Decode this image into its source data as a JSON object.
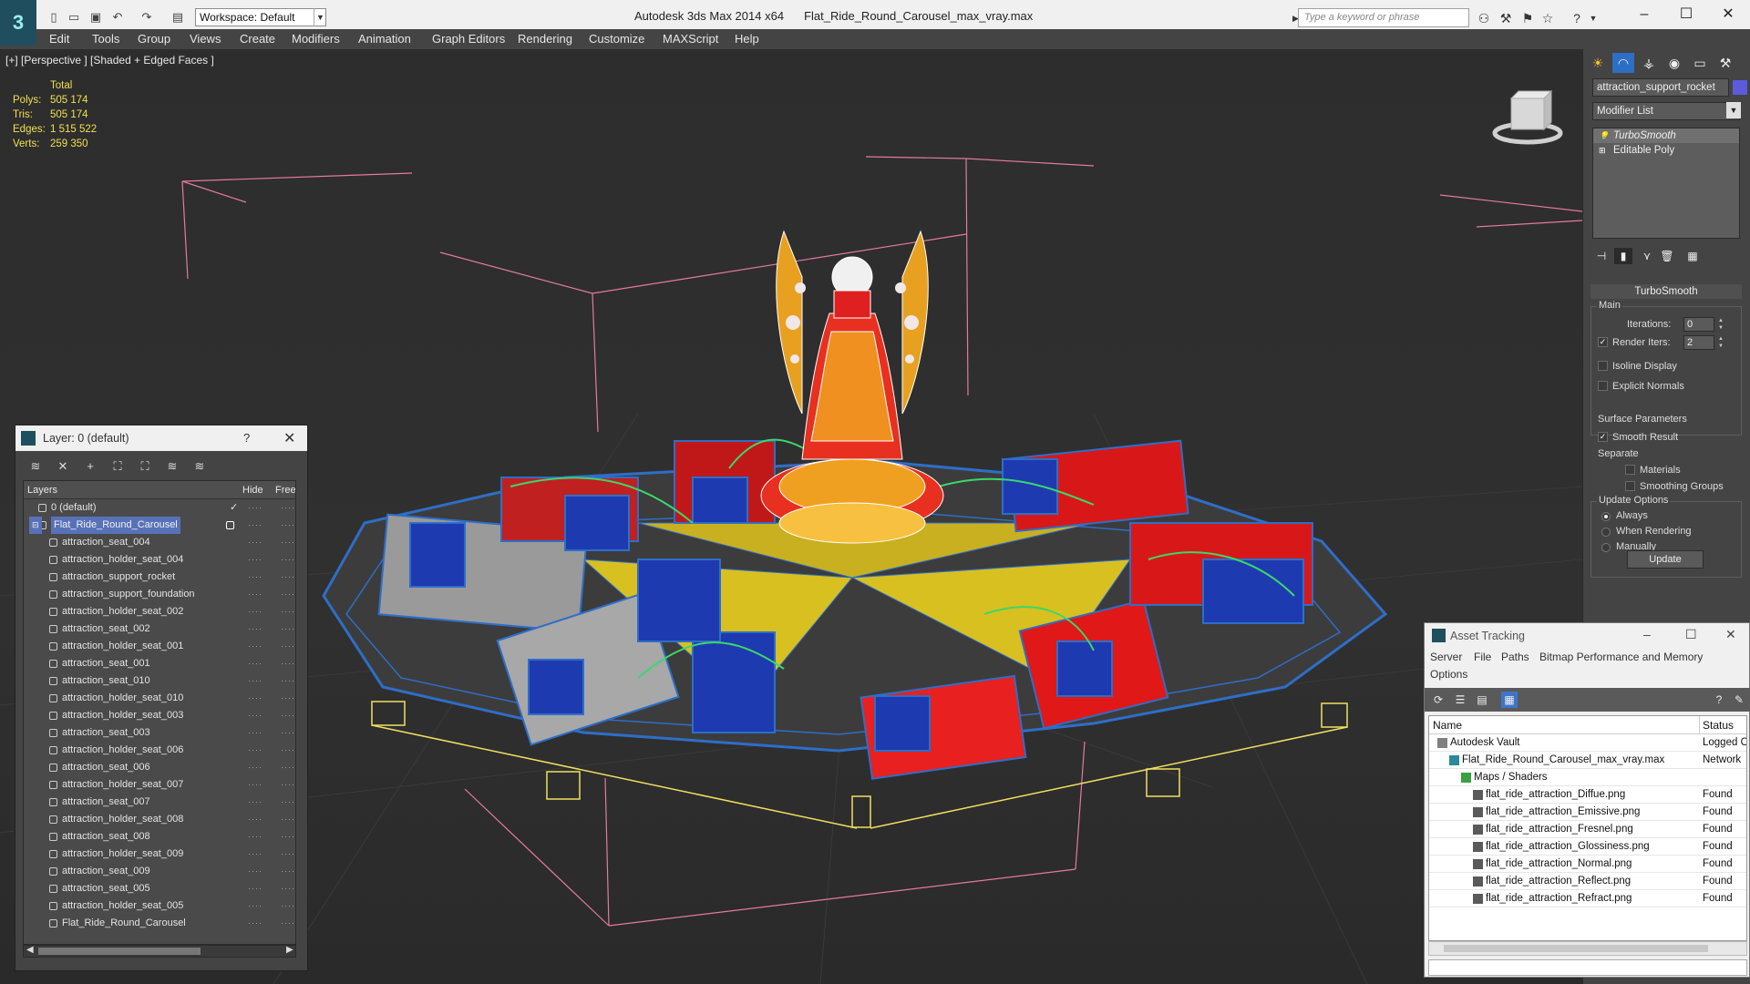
{
  "titlebar": {
    "workspace": "Workspace: Default",
    "app_name": "Autodesk 3ds Max  2014 x64",
    "file_name": "Flat_Ride_Round_Carousel_max_vray.max",
    "search_placeholder": "Type a keyword or phrase"
  },
  "menu": [
    "Edit",
    "Tools",
    "Group",
    "Views",
    "Create",
    "Modifiers",
    "Animation",
    "Graph Editors",
    "Rendering",
    "Customize",
    "MAXScript",
    "Help"
  ],
  "viewport": {
    "label": "[+] [Perspective ] [Shaded + Edged Faces ]",
    "stats_header": "Total",
    "stats": [
      {
        "name": "Polys:",
        "value": "505 174"
      },
      {
        "name": "Tris:",
        "value": "505 174"
      },
      {
        "name": "Edges:",
        "value": "1 515 522"
      },
      {
        "name": "Verts:",
        "value": "259 350"
      }
    ]
  },
  "command_panel": {
    "object_name": "attraction_support_rocket",
    "object_color": "#5b5bdc",
    "modifier_list": "Modifier List",
    "stack": [
      "TurboSmooth",
      "Editable Poly"
    ],
    "rollout": "TurboSmooth",
    "main_group": "Main",
    "iterations_label": "Iterations:",
    "iterations_value": "0",
    "render_iters_label": "Render Iters:",
    "render_iters_value": "2",
    "isoline_label": "Isoline Display",
    "explicit_normals_label": "Explicit Normals",
    "surface_group": "Surface Parameters",
    "smooth_result_label": "Smooth Result",
    "separate_label": "Separate",
    "materials_label": "Materials",
    "smoothing_groups_label": "Smoothing Groups",
    "update_group": "Update Options",
    "always_label": "Always",
    "when_rendering_label": "When Rendering",
    "manually_label": "Manually",
    "update_button": "Update"
  },
  "layer_dialog": {
    "title": "Layer: 0 (default)",
    "help": "?",
    "columns": [
      "Layers",
      "Hide",
      "Free"
    ],
    "layers": [
      {
        "name": "0 (default)",
        "level": 0,
        "kind": "layer"
      },
      {
        "name": "Flat_Ride_Round_Carousel",
        "level": 0,
        "kind": "layer",
        "selected": true
      },
      {
        "name": "attraction_seat_004",
        "level": 1,
        "kind": "object"
      },
      {
        "name": "attraction_holder_seat_004",
        "level": 1,
        "kind": "object"
      },
      {
        "name": "attraction_support_rocket",
        "level": 1,
        "kind": "object"
      },
      {
        "name": "attraction_support_foundation",
        "level": 1,
        "kind": "object"
      },
      {
        "name": "attraction_holder_seat_002",
        "level": 1,
        "kind": "object"
      },
      {
        "name": "attraction_seat_002",
        "level": 1,
        "kind": "object"
      },
      {
        "name": "attraction_holder_seat_001",
        "level": 1,
        "kind": "object"
      },
      {
        "name": "attraction_seat_001",
        "level": 1,
        "kind": "object"
      },
      {
        "name": "attraction_seat_010",
        "level": 1,
        "kind": "object"
      },
      {
        "name": "attraction_holder_seat_010",
        "level": 1,
        "kind": "object"
      },
      {
        "name": "attraction_holder_seat_003",
        "level": 1,
        "kind": "object"
      },
      {
        "name": "attraction_seat_003",
        "level": 1,
        "kind": "object"
      },
      {
        "name": "attraction_holder_seat_006",
        "level": 1,
        "kind": "object"
      },
      {
        "name": "attraction_seat_006",
        "level": 1,
        "kind": "object"
      },
      {
        "name": "attraction_holder_seat_007",
        "level": 1,
        "kind": "object"
      },
      {
        "name": "attraction_seat_007",
        "level": 1,
        "kind": "object"
      },
      {
        "name": "attraction_holder_seat_008",
        "level": 1,
        "kind": "object"
      },
      {
        "name": "attraction_seat_008",
        "level": 1,
        "kind": "object"
      },
      {
        "name": "attraction_holder_seat_009",
        "level": 1,
        "kind": "object"
      },
      {
        "name": "attraction_seat_009",
        "level": 1,
        "kind": "object"
      },
      {
        "name": "attraction_seat_005",
        "level": 1,
        "kind": "object"
      },
      {
        "name": "attraction_holder_seat_005",
        "level": 1,
        "kind": "object"
      },
      {
        "name": "Flat_Ride_Round_Carousel",
        "level": 1,
        "kind": "object"
      }
    ]
  },
  "asset_tracking": {
    "title": "Asset Tracking",
    "menu": [
      "Server",
      "File",
      "Paths",
      "Bitmap Performance and Memory",
      "Options"
    ],
    "columns": [
      "Name",
      "Status"
    ],
    "rows": [
      {
        "name": "Autodesk Vault",
        "status": "Logged O",
        "level": 1,
        "icon": "vault"
      },
      {
        "name": "Flat_Ride_Round_Carousel_max_vray.max",
        "status": "Network",
        "level": 2,
        "icon": "max"
      },
      {
        "name": "Maps / Shaders",
        "status": "",
        "level": 3,
        "icon": "folder"
      },
      {
        "name": "flat_ride_attraction_Diffue.png",
        "status": "Found",
        "level": 4,
        "icon": "bitmap"
      },
      {
        "name": "flat_ride_attraction_Emissive.png",
        "status": "Found",
        "level": 4,
        "icon": "bitmap"
      },
      {
        "name": "flat_ride_attraction_Fresnel.png",
        "status": "Found",
        "level": 4,
        "icon": "bitmap"
      },
      {
        "name": "flat_ride_attraction_Glossiness.png",
        "status": "Found",
        "level": 4,
        "icon": "bitmap"
      },
      {
        "name": "flat_ride_attraction_Normal.png",
        "status": "Found",
        "level": 4,
        "icon": "bitmap"
      },
      {
        "name": "flat_ride_attraction_Reflect.png",
        "status": "Found",
        "level": 4,
        "icon": "bitmap"
      },
      {
        "name": "flat_ride_attraction_Refract.png",
        "status": "Found",
        "level": 4,
        "icon": "bitmap"
      }
    ]
  }
}
